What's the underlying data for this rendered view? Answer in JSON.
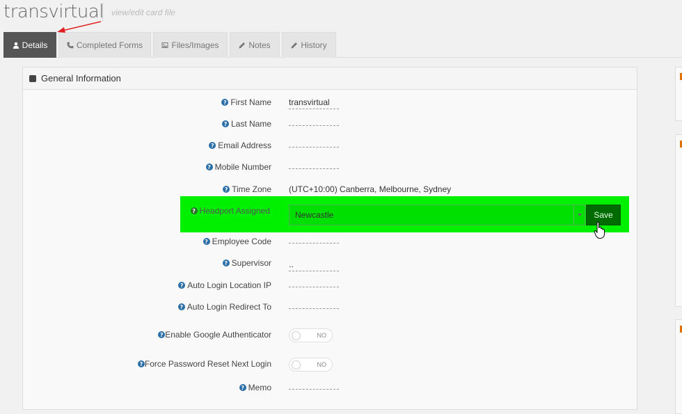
{
  "header": {
    "title": "transvirtual",
    "subtitle": "view/edit card file"
  },
  "tabs": [
    {
      "label": "Details",
      "icon": "user-icon",
      "active": true
    },
    {
      "label": "Completed Forms",
      "icon": "phone-icon",
      "active": false
    },
    {
      "label": "Files/Images",
      "icon": "image-icon",
      "active": false
    },
    {
      "label": "Notes",
      "icon": "pencil-icon",
      "active": false
    },
    {
      "label": "History",
      "icon": "pencil-icon",
      "active": false
    }
  ],
  "panel": {
    "title": "General Information",
    "fields": {
      "first_name": {
        "label": "First Name",
        "value": "transvirtual"
      },
      "last_name": {
        "label": "Last Name",
        "value": ""
      },
      "email": {
        "label": "Email Address",
        "value": ""
      },
      "mobile": {
        "label": "Mobile Number",
        "value": ""
      },
      "timezone": {
        "label": "Time Zone",
        "value": "(UTC+10:00) Canberra, Melbourne, Sydney"
      },
      "headport": {
        "label": "Headport Assigned",
        "value": "Newcastle",
        "save_label": "Save"
      },
      "employee_code": {
        "label": "Employee Code",
        "value": ""
      },
      "supervisor": {
        "label": "Supervisor",
        "value": ".."
      },
      "auto_login_ip": {
        "label": "Auto Login Location IP",
        "value": ""
      },
      "auto_login_redirect": {
        "label": "Auto Login Redirect To",
        "value": ""
      },
      "google_auth": {
        "label": "Enable Google Authenticator",
        "toggle": "NO"
      },
      "force_reset": {
        "label": "Force Password Reset Next Login",
        "toggle": "NO"
      },
      "memo": {
        "label": "Memo",
        "value": ""
      }
    }
  },
  "colors": {
    "highlight": "#00f000",
    "save_button": "#006b00",
    "tab_active": "#555555",
    "help_icon": "#2a6ea8",
    "arrow": "#e02020"
  }
}
